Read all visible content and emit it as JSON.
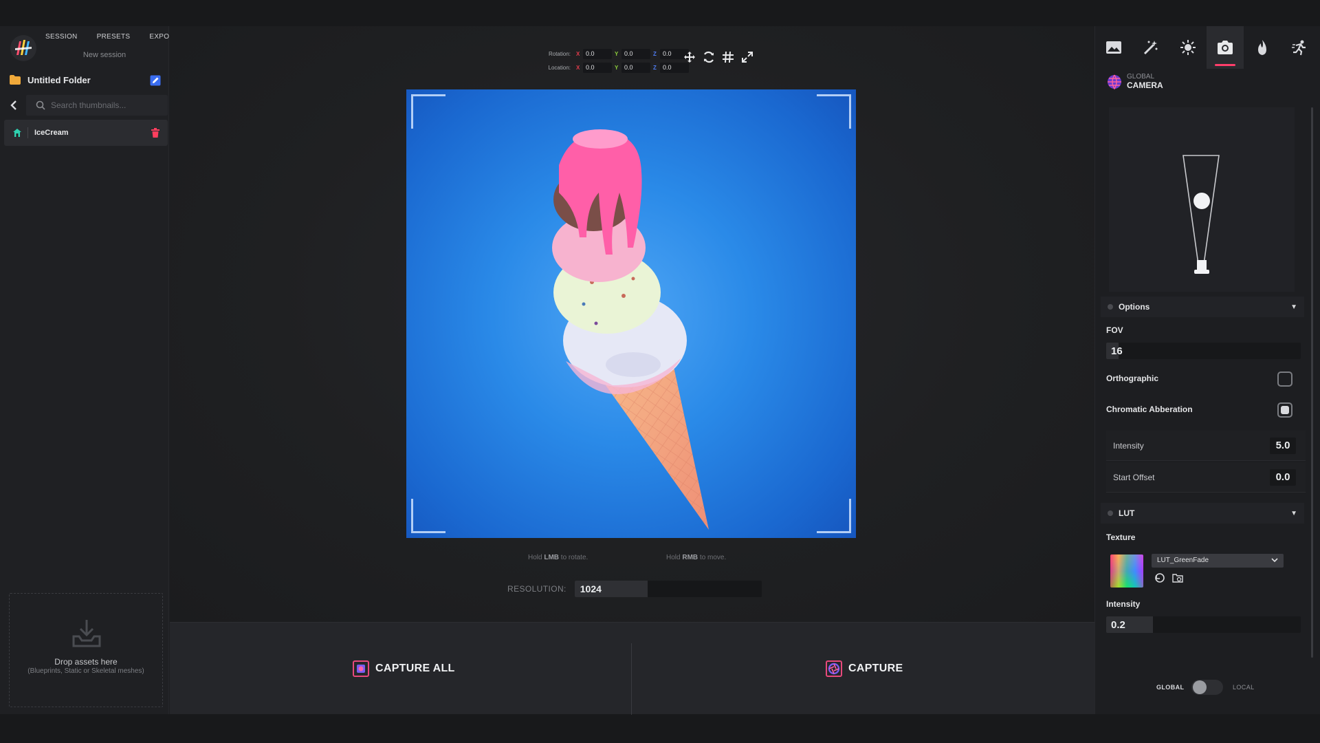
{
  "menu": {
    "session": "SESSION",
    "presets": "PRESETS",
    "export": "EXPORT"
  },
  "session_name": "New session",
  "folder": {
    "name": "Untitled Folder"
  },
  "search": {
    "placeholder": "Search thumbnails..."
  },
  "assets": [
    {
      "name": "IceCream",
      "icon": "mesh-icon"
    }
  ],
  "drop": {
    "title": "Drop assets here",
    "subtitle": "(Blueprints, Static or Skeletal meshes)"
  },
  "transform": {
    "rotation_label": "Rotation:",
    "location_label": "Location:",
    "axes": {
      "x": "X",
      "y": "Y",
      "z": "Z"
    },
    "rotation": {
      "x": "0.0",
      "y": "0.0",
      "z": "0.0"
    },
    "location": {
      "x": "0.0",
      "y": "0.0",
      "z": "0.0"
    }
  },
  "tools": [
    "move-icon",
    "rotate-icon",
    "grid-icon",
    "fullscreen-icon"
  ],
  "hints": {
    "rotate_pre": "Hold ",
    "rotate_key": "LMB",
    "rotate_post": " to rotate.",
    "move_pre": "Hold ",
    "move_key": "RMB",
    "move_post": " to move."
  },
  "resolution": {
    "label": "RESOLUTION:",
    "value": "1024",
    "fill_fraction": 0.39
  },
  "capture": {
    "all_label": "CAPTURE ALL",
    "single_label": "CAPTURE"
  },
  "right_tabs": [
    "image-icon",
    "magic-wand-icon",
    "sun-icon",
    "camera-icon",
    "flame-icon",
    "animation-icon"
  ],
  "active_tab": "camera-icon",
  "camera_header": {
    "scope": "GLOBAL",
    "title": "CAMERA"
  },
  "options": {
    "title": "Options",
    "fov_label": "FOV",
    "fov_value": "16",
    "orthographic_label": "Orthographic",
    "orthographic_checked": false,
    "chromatic_label": "Chromatic Abberation",
    "chromatic_checked": true,
    "intensity_label": "Intensity",
    "intensity_value": "5.0",
    "start_offset_label": "Start Offset",
    "start_offset_value": "0.0"
  },
  "lut": {
    "title": "LUT",
    "texture_label": "Texture",
    "texture_value": "LUT_GreenFade",
    "intensity_label": "Intensity",
    "intensity_value": "0.2",
    "intensity_fill_fraction": 0.24
  },
  "space_toggle": {
    "global": "GLOBAL",
    "local": "LOCAL",
    "value": "GLOBAL"
  },
  "colors": {
    "accent": "#ff3e6b",
    "sky": "#2a8ae8",
    "x_axis": "#e23b4b",
    "y_axis": "#8fd13b",
    "z_axis": "#4f7bf0"
  }
}
